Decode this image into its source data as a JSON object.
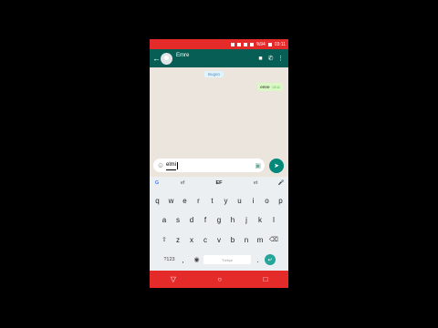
{
  "status_bar": {
    "battery": "%94",
    "time": "03:11"
  },
  "app_bar": {
    "contact_name": "Emre"
  },
  "chat": {
    "date_chip": "Bugün",
    "messages": [
      {
        "text": "emre",
        "time": "03:11"
      }
    ]
  },
  "composer": {
    "text": "elmi",
    "send_icon": "send-icon"
  },
  "keyboard": {
    "suggestions": [
      "ef",
      "EF",
      "et"
    ],
    "row1": [
      "q",
      "w",
      "e",
      "r",
      "t",
      "y",
      "u",
      "i",
      "o",
      "p"
    ],
    "row2": [
      "a",
      "s",
      "d",
      "f",
      "g",
      "h",
      "j",
      "k",
      "l"
    ],
    "row3": [
      "z",
      "x",
      "c",
      "v",
      "b",
      "n",
      "m"
    ],
    "symbols_label": "?123",
    "comma": ",",
    "period": ".",
    "space_label": "Türkçe"
  },
  "colors": {
    "status_red": "#e52a2a",
    "whatsapp_green": "#075e54",
    "teal": "#00897b"
  }
}
